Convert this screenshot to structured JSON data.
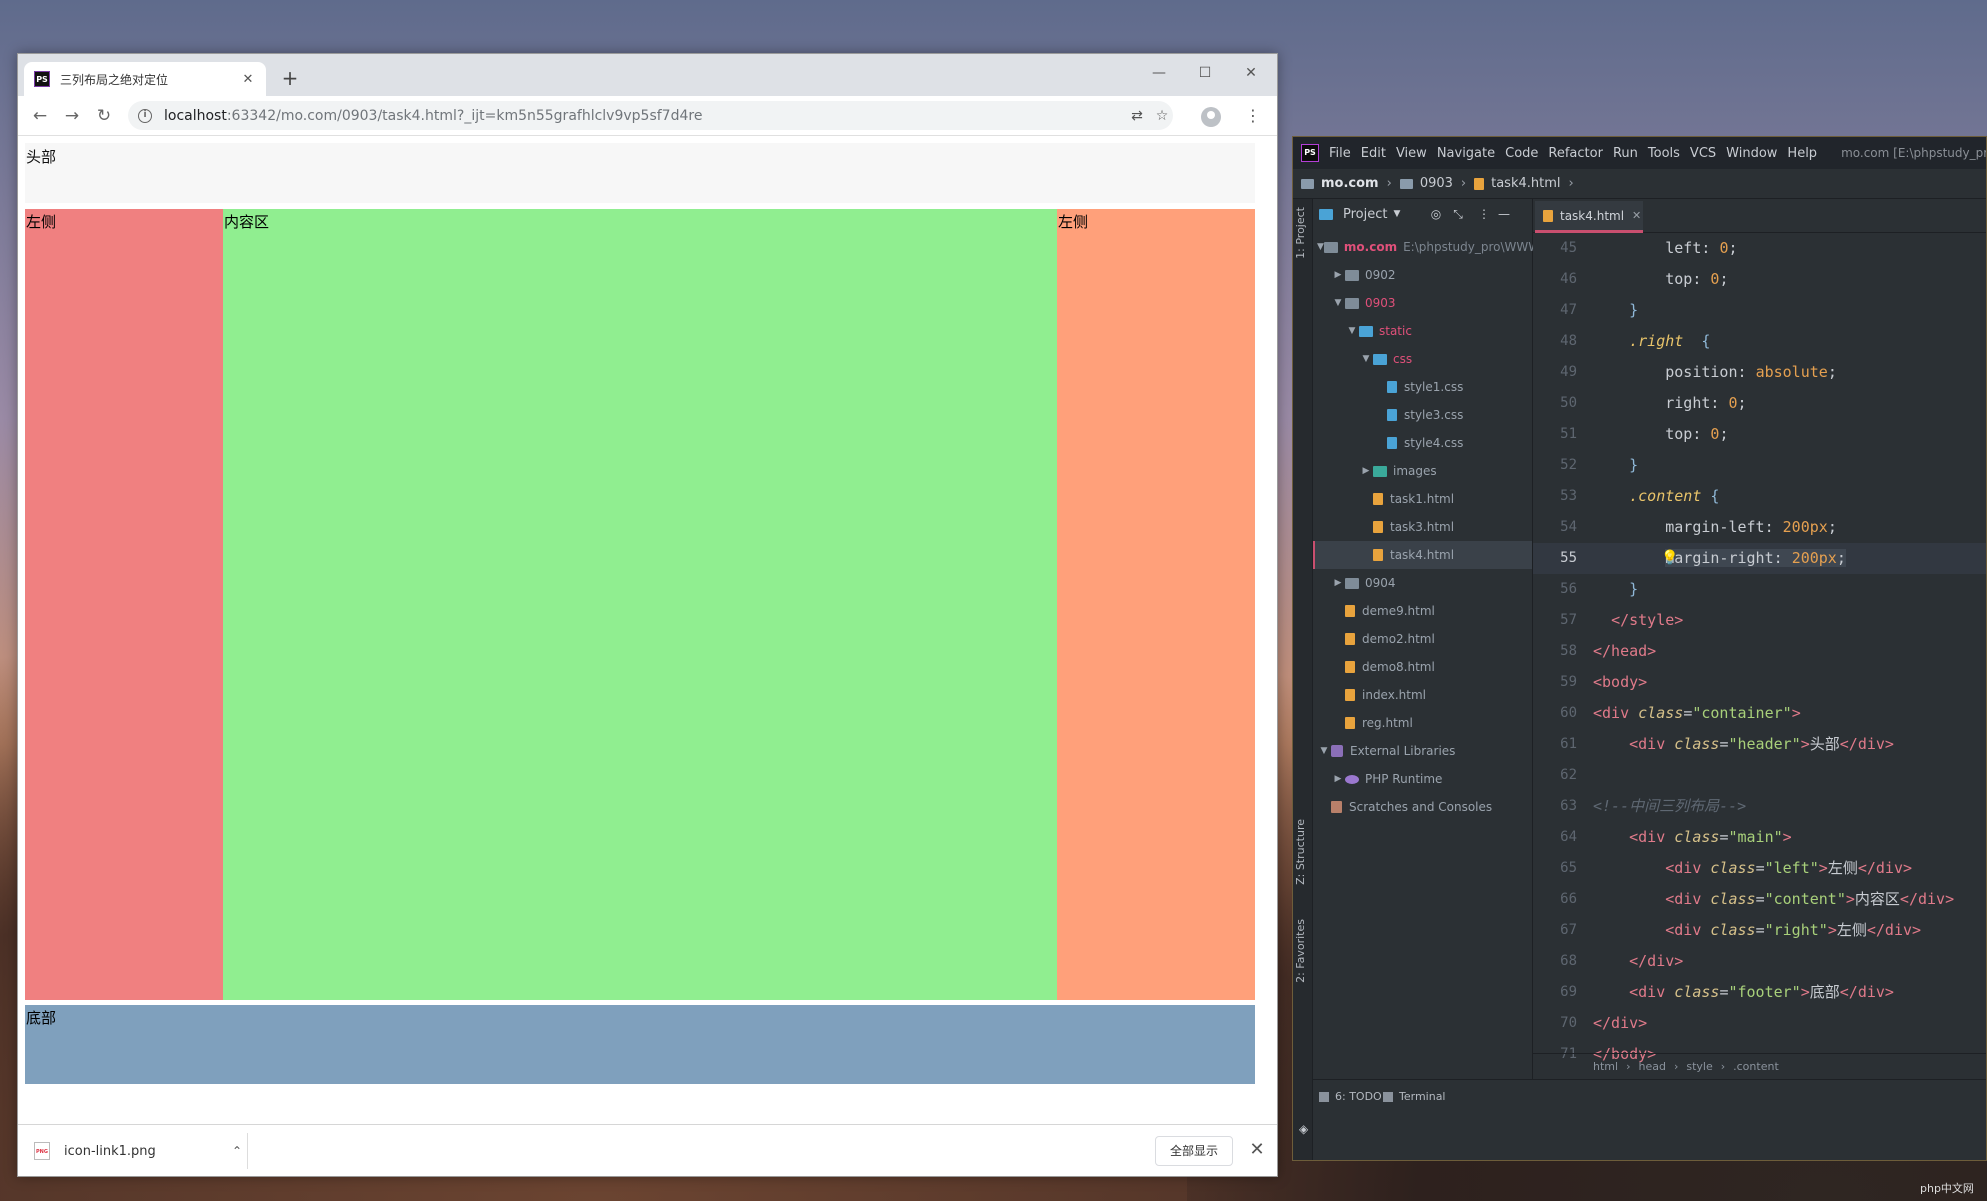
{
  "browser": {
    "tab_title": "三列布局之绝对定位",
    "favicon_text": "PS",
    "url_host": "localhost",
    "url_rest": ":63342/mo.com/0903/task4.html?_ijt=km5n55grafhlclv9vp5sf7d4re",
    "window_controls": {
      "minimize": "—",
      "maximize": "☐",
      "close": "✕"
    },
    "page": {
      "header": "头部",
      "left": "左侧",
      "content": "内容区",
      "right": "左侧",
      "footer": "底部",
      "colors": {
        "header": "#f7f7f7",
        "left": "#f08080",
        "content": "#90ee90",
        "right": "#ffa07a",
        "footer": "#7fa0bd"
      }
    },
    "download": {
      "file_name": "icon-link1.png",
      "icon_text": "PNG",
      "show_all": "全部显示"
    }
  },
  "ide": {
    "logo": "PS",
    "menu": [
      "File",
      "Edit",
      "View",
      "Navigate",
      "Code",
      "Refactor",
      "Run",
      "Tools",
      "VCS",
      "Window",
      "Help"
    ],
    "window_title": "mo.com [E:\\phpstudy_pro",
    "nav": {
      "root": "mo.com",
      "folder": "0903",
      "file": "task4.html"
    },
    "side_tabs": {
      "project": "1: Project",
      "structure": "Z: Structure",
      "favorites": "2: Favorites"
    },
    "project_panel": {
      "title": "Project",
      "tree": [
        {
          "label": "mo.com",
          "extra": "E:\\phpstudy_pro\\WWW",
          "type": "folder",
          "style": "root"
        },
        {
          "label": "0902",
          "type": "folder"
        },
        {
          "label": "0903",
          "type": "folder",
          "style": "pink"
        },
        {
          "label": "static",
          "type": "folder-blue",
          "style": "pink"
        },
        {
          "label": "css",
          "type": "folder-blue",
          "style": "pink"
        },
        {
          "label": "style1.css",
          "type": "css"
        },
        {
          "label": "style3.css",
          "type": "css"
        },
        {
          "label": "style4.css",
          "type": "css"
        },
        {
          "label": "images",
          "type": "folder-teal"
        },
        {
          "label": "task1.html",
          "type": "html"
        },
        {
          "label": "task3.html",
          "type": "html"
        },
        {
          "label": "task4.html",
          "type": "html",
          "selected": true
        },
        {
          "label": "0904",
          "type": "folder"
        },
        {
          "label": "deme9.html",
          "type": "html"
        },
        {
          "label": "demo2.html",
          "type": "html"
        },
        {
          "label": "demo8.html",
          "type": "html"
        },
        {
          "label": "index.html",
          "type": "html"
        },
        {
          "label": "reg.html",
          "type": "html"
        },
        {
          "label": "External Libraries",
          "type": "lib"
        },
        {
          "label": "PHP Runtime",
          "type": "php"
        },
        {
          "label": "Scratches and Consoles",
          "type": "scratch"
        }
      ]
    },
    "editor": {
      "tab": "task4.html",
      "line_numbers": [
        "45",
        "46",
        "47",
        "48",
        "49",
        "50",
        "51",
        "52",
        "53",
        "54",
        "55",
        "56",
        "57",
        "58",
        "59",
        "60",
        "61",
        "62",
        "63",
        "64",
        "65",
        "66",
        "67",
        "68",
        "69",
        "70",
        "71"
      ],
      "breadcrumb": [
        "html",
        "head",
        "style",
        ".content"
      ]
    },
    "bottom_tabs": {
      "todo": "6: TODO",
      "terminal": "Terminal"
    }
  },
  "watermark": "php中文网"
}
